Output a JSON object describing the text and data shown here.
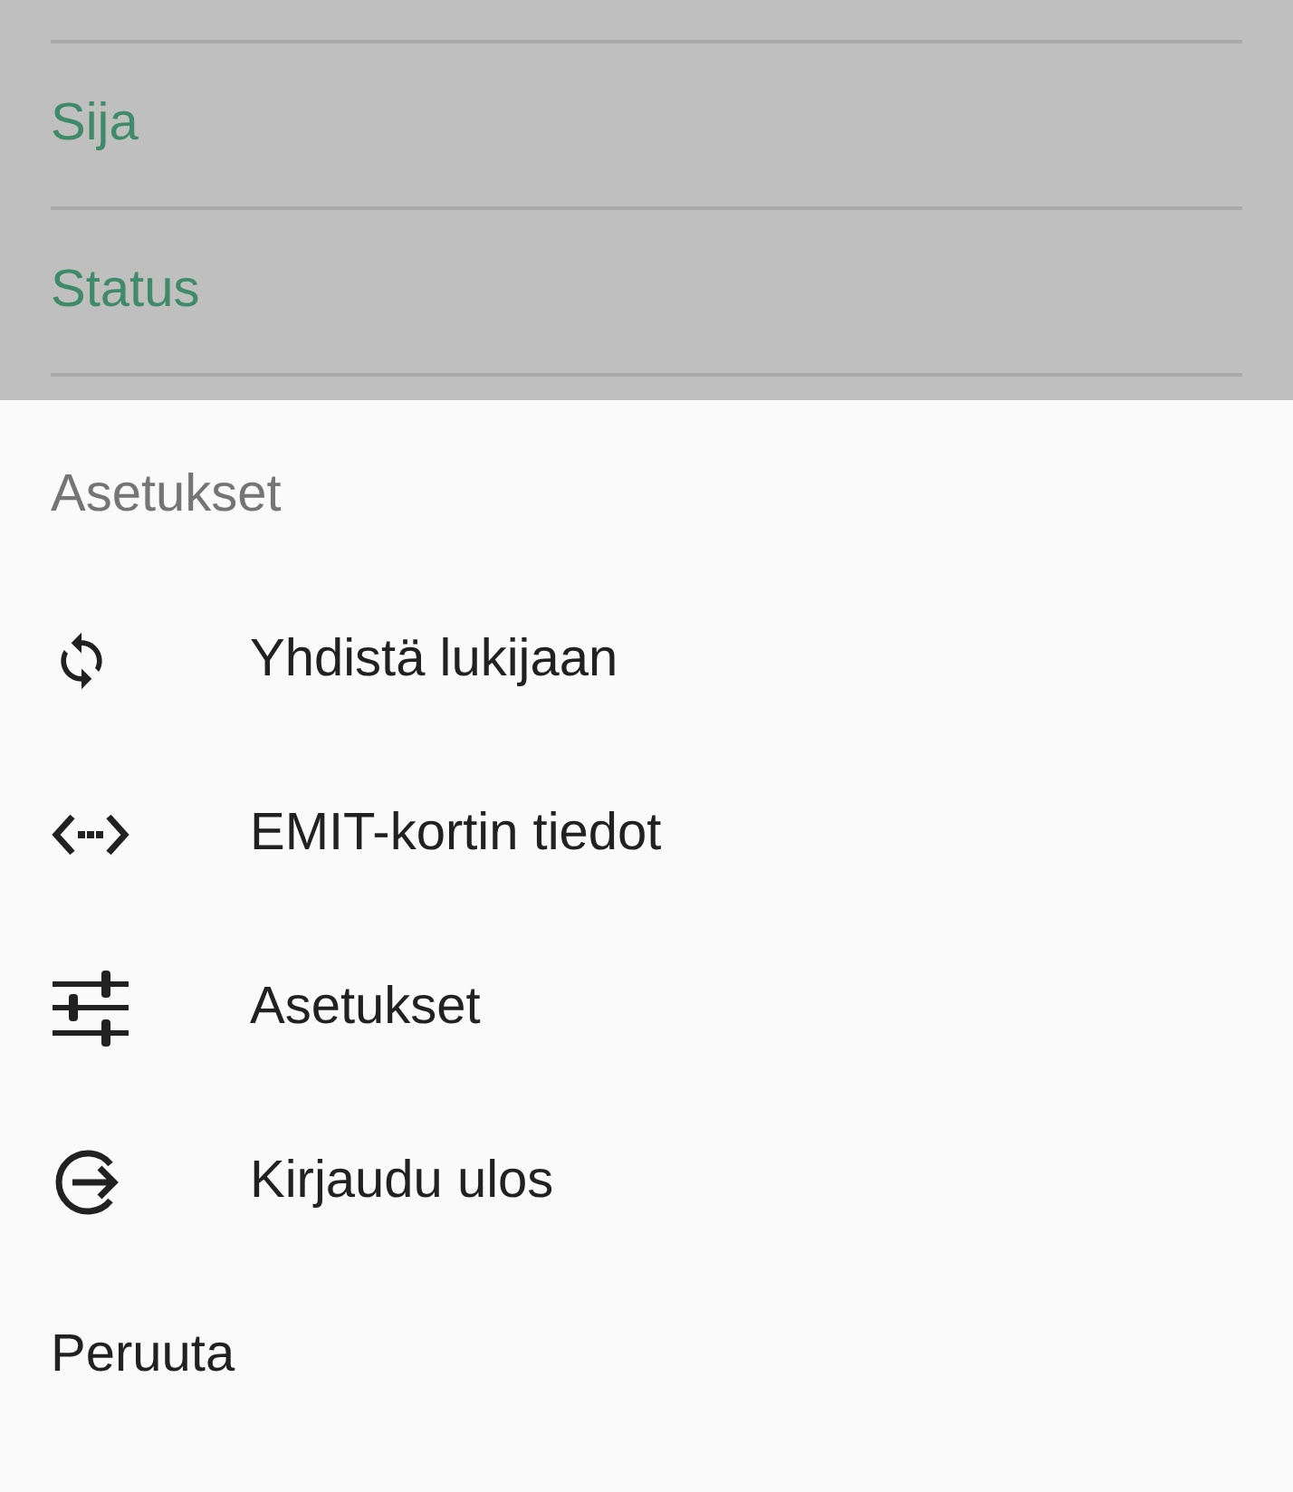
{
  "background_list": {
    "items": [
      {
        "label": "Sija"
      },
      {
        "label": "Status"
      }
    ]
  },
  "bottom_sheet": {
    "title": "Asetukset",
    "items": [
      {
        "kind": "sync",
        "label": "Yhdistä lukijaan"
      },
      {
        "kind": "code",
        "label": "EMIT-kortin tiedot"
      },
      {
        "kind": "tune",
        "label": "Asetukset"
      },
      {
        "kind": "logout",
        "label": "Kirjaudu ulos"
      },
      {
        "kind": "plain",
        "label": "Peruuta"
      }
    ]
  }
}
